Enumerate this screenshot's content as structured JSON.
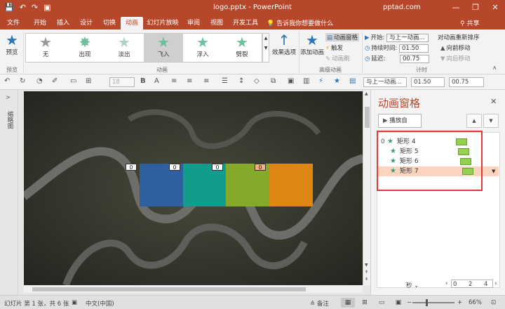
{
  "titlebar": {
    "title": "logo.pptx  -  PowerPoint",
    "brand": "pptad.com",
    "qat": [
      "💾",
      "↶",
      "↷",
      "▣"
    ],
    "window_controls": [
      "—",
      "❐",
      "✕"
    ],
    "share_label": "共享",
    "background": "#b7472a"
  },
  "tabs": [
    {
      "label": "文件"
    },
    {
      "label": "开始"
    },
    {
      "label": "插入"
    },
    {
      "label": "设计"
    },
    {
      "label": "切换"
    },
    {
      "label": "动画"
    },
    {
      "label": "幻灯片放映"
    },
    {
      "label": "审阅"
    },
    {
      "label": "视图"
    },
    {
      "label": "开发工具"
    }
  ],
  "active_tab": "动画",
  "tell_me": "告诉我你想要做什么",
  "ribbon": {
    "preview_label": "预览",
    "preview_group": "预览",
    "gallery": [
      {
        "label": "无",
        "icon": "star-icon"
      },
      {
        "label": "出现",
        "icon": "star-burst-icon"
      },
      {
        "label": "淡出",
        "icon": "star-icon"
      },
      {
        "label": "飞入",
        "icon": "star-fly-icon"
      },
      {
        "label": "浮入",
        "icon": "star-float-icon"
      },
      {
        "label": "劈裂",
        "icon": "star-split-icon"
      }
    ],
    "gallery_selected": "飞入",
    "effect_options_label": "效果选项",
    "animation_group": "动画",
    "add_animation_label": "添加动画",
    "animation_pane_label": "动画窗格",
    "trigger_label": "触发",
    "animation_painter_label": "动画刷",
    "advanced_group": "高级动画",
    "start_label": "开始:",
    "start_value": "与上一动画...",
    "duration_label": "持续时间:",
    "duration_value": "01.50",
    "delay_label": "延迟:",
    "delay_value": "00.75",
    "reorder_label": "对动画重新排序",
    "move_earlier_label": "向前移动",
    "move_later_label": "向后移动",
    "timing_group": "计时"
  },
  "format_toolbar": {
    "font_size": "18",
    "start_value": "与上一动画...",
    "duration_value": "01.50",
    "delay_value": "00.75",
    "bold": "B",
    "italic": "A"
  },
  "thumbnails": {
    "label": "缩略图"
  },
  "slide": {
    "rects": [
      {
        "color": "#2e5f9e",
        "tag": "0"
      },
      {
        "color": "#129c8c",
        "tag": "0"
      },
      {
        "color": "#84a92b",
        "tag": "0"
      },
      {
        "color": "#df8514",
        "tag": "0"
      }
    ],
    "first_tag": "0"
  },
  "anim_pane": {
    "title": "动画窗格",
    "play_label": "播放自",
    "items": [
      {
        "index": "0",
        "name": "矩形 4"
      },
      {
        "index": "",
        "name": "矩形 5"
      },
      {
        "index": "",
        "name": "矩形 6"
      },
      {
        "index": "",
        "name": "矩形 7"
      }
    ],
    "selected_item": "矩形 7",
    "seconds_label": "秒",
    "timeline": [
      "0",
      "2",
      "4"
    ]
  },
  "statusbar": {
    "slide_info": "幻灯片 第 1 张，共 6 张",
    "language": "中文(中国)",
    "notes_label": "备注",
    "zoom": "66%"
  }
}
